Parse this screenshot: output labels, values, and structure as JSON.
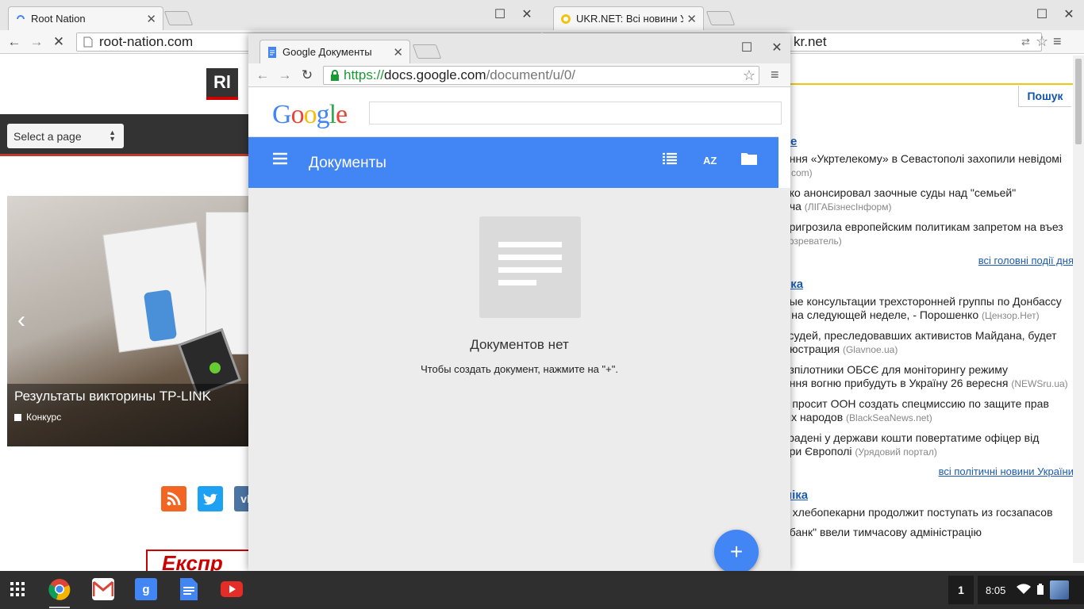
{
  "window_root": {
    "tab_title": "Root Nation",
    "url": "root-nation.com",
    "logo": "Rl",
    "select_page": "Select a page",
    "slider": {
      "title": "Результаты викторины TP-LINK",
      "category": "Конкурс"
    },
    "banner": "Експр"
  },
  "window_ukr": {
    "tab_title": "UKR.NET: Всі новини Ук",
    "url": "kr.net",
    "search_button": "Пошук",
    "sections": [
      {
        "heading": "не",
        "items": [
          {
            "text": "ення «Укртелекому» в Севастополі захопили невідомі",
            "line2": "",
            "source": "a.com)"
          },
          {
            "text": "нко анонсировал заочные суды над \"семьей\"",
            "line2": "ича",
            "source": "(ЛІГАБізнесІнформ)"
          },
          {
            "text": "пригрозила европейским политикам запретом на въез",
            "line2": "",
            "source": "бозреватель)"
          }
        ],
        "more": "всі головні події дня"
      },
      {
        "heading": "ика",
        "items": [
          {
            "text": "ные консультации трехсторонней группы по Донбассу",
            "line2": "т на следующей неделе, - Порошенко",
            "source": "(Цензор.Нет)"
          },
          {
            "text": "′ судей, преследовавших активистов Майдана, будет",
            "line2": "люстрация",
            "source": "(Glavnoe.ua)"
          },
          {
            "text": "езпілотники ОБСЄ для моніторингу режиму",
            "line2": "ення вогню прибудуть в Україну 26 вересня",
            "source": "(NEWSru.ua)"
          },
          {
            "text": "в просит ООН создать спецмиссию по защите прав",
            "line2": "ых народов",
            "source": "(BlackSeaNews.net)"
          },
          {
            "text": "крадені у держави кошти повертатиме офіцер від",
            "line2": "при Європолі",
            "source": "(Урядовий портал)"
          }
        ],
        "more": "всі політичні новини України"
      },
      {
        "heading": "міка",
        "items": [
          {
            "text": "а хлебопекарни продолжит поступать из госзапасов",
            "line2": "",
            "source": ""
          },
          {
            "text": "обанк\" ввели тимчасову адміністрацію",
            "line2": "",
            "source": ""
          }
        ],
        "more": ""
      }
    ]
  },
  "window_docs": {
    "tab_title": "Google Документы",
    "url_scheme": "https://",
    "url_host": "docs.google.com",
    "url_path": "/document/u/0/",
    "app_title": "Документы",
    "empty_title": "Документов нет",
    "empty_hint": "Чтобы создать документ, нажмите на \"+\".",
    "fab": "+"
  },
  "shelf": {
    "apps": [
      "app-launcher",
      "chrome",
      "gmail",
      "google-search",
      "google-docs",
      "youtube"
    ],
    "notification_count": "1",
    "time": "8:05"
  },
  "colors": {
    "google_blue": "#4285f4",
    "root_red": "#c0392b",
    "ukr_link": "#1a5bb5"
  }
}
